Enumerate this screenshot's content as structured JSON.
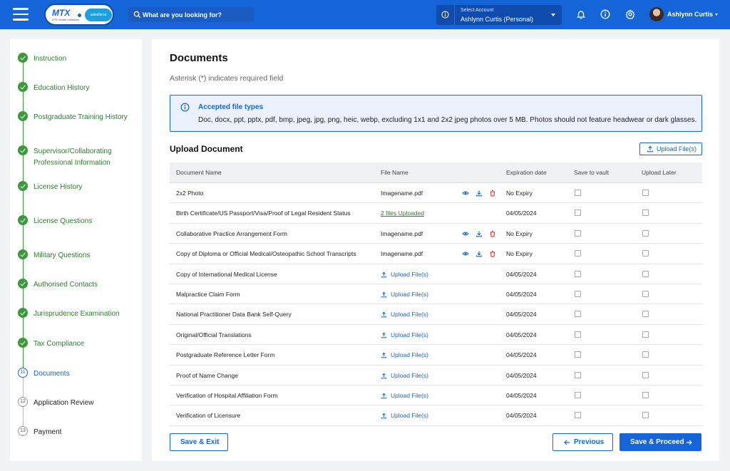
{
  "header": {
    "search_placeholder": "What are you looking for?",
    "logo_text": "MTX",
    "logo_sub": "LPS Health Initiatives",
    "logo_partner": "salesforce",
    "account_label": "Select Account",
    "account_value": "Ashlynn Curtis (Personal)",
    "user_name": "Ashlynn Curtis",
    "brand_color": "#1565d8"
  },
  "steps": [
    {
      "num": "1",
      "label": "Instruction",
      "status": "done"
    },
    {
      "num": "2",
      "label": "Education History",
      "status": "done"
    },
    {
      "num": "3",
      "label": "Postgraduate Training History",
      "status": "done"
    },
    {
      "num": "4",
      "label": "Supervisor/Collaborating Professional Information",
      "status": "done"
    },
    {
      "num": "5",
      "label": "License History",
      "status": "done"
    },
    {
      "num": "6",
      "label": "License Questions",
      "status": "done"
    },
    {
      "num": "7",
      "label": "Military Questions",
      "status": "done"
    },
    {
      "num": "8",
      "label": "Authorised Contacts",
      "status": "done"
    },
    {
      "num": "9",
      "label": "Jurisprudence Examination",
      "status": "done"
    },
    {
      "num": "10",
      "label": "Tax Compliance",
      "status": "done"
    },
    {
      "num": "11",
      "label": "Documents",
      "status": "current"
    },
    {
      "num": "12",
      "label": "Application Review",
      "status": "todo"
    },
    {
      "num": "13",
      "label": "Payment",
      "status": "todo"
    }
  ],
  "main": {
    "title": "Documents",
    "required_prefix": "Asterisk (",
    "required_star": "*",
    "required_suffix": ") indicates required field",
    "notice_title": "Accepted file types",
    "notice_text": "Doc, docx, ppt, pptx, pdf, bmp, jpeg, jpg, png, heic, webp, excluding 1x1 and 2x2 jpeg photos over 5 MB. Photos should not feature headwear or dark glasses.",
    "upload_heading": "Upload Document",
    "upload_button": "Upload File(s)"
  },
  "table": {
    "columns": [
      "Document Name",
      "File Name",
      "Expiration date",
      "Save to vault",
      "Upload Later"
    ],
    "rows": [
      {
        "name": "2x2 Photo",
        "file": "Imagename.pdf",
        "type": "file",
        "expiry": "No Expiry"
      },
      {
        "name": "Birth Certificate/US Passport/Visa/Proof of Legal Resident Status",
        "file": "2 files Uploaded",
        "type": "link",
        "expiry": "04/05/2024"
      },
      {
        "name": "Collaborative Practice Arrangement Form",
        "file": "Imagename.pdf",
        "type": "file",
        "expiry": "No Expiry"
      },
      {
        "name": "Copy of Diploma or Official Medical/Osteopathic School Transcripts",
        "file": "Imagename.pdf",
        "type": "file",
        "expiry": "No Expiry"
      },
      {
        "name": "Copy of International Medical License",
        "file": "Upload File(s)",
        "type": "upload",
        "expiry": "04/05/2024"
      },
      {
        "name": "Malpractice Claim Form",
        "file": "Upload File(s)",
        "type": "upload",
        "expiry": "04/05/2024"
      },
      {
        "name": "National Practitioner Data Bank Self-Query",
        "file": "Upload File(s)",
        "type": "upload",
        "expiry": "04/05/2024"
      },
      {
        "name": "Original/Official Translations",
        "file": "Upload File(s)",
        "type": "upload",
        "expiry": "04/05/2024"
      },
      {
        "name": "Postgraduate Reference Letter Form",
        "file": "Upload File(s)",
        "type": "upload",
        "expiry": "04/05/2024"
      },
      {
        "name": "Proof of Name Change",
        "file": "Upload File(s)",
        "type": "upload",
        "expiry": "04/05/2024"
      },
      {
        "name": "Verification of Hospital Affiliation Form",
        "file": "Upload File(s)",
        "type": "upload",
        "expiry": "04/05/2024"
      },
      {
        "name": "Verification of Licensure",
        "file": "Upload File(s)",
        "type": "upload",
        "expiry": "04/05/2024"
      }
    ]
  },
  "footer": {
    "save_exit": "Save & Exit",
    "previous": "Previous",
    "save_proceed": "Save & Proceed"
  }
}
